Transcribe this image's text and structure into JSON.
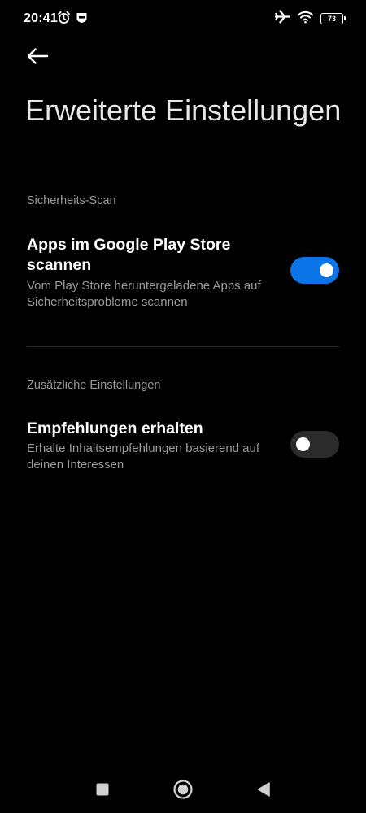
{
  "status_bar": {
    "time": "20:41",
    "battery_level": "73",
    "left_icons": [
      "alarm-icon",
      "notification-app-icon"
    ],
    "right_icons": [
      "airplane-mode-icon",
      "wifi-icon",
      "battery-icon"
    ]
  },
  "header": {
    "back_icon": "arrow-left-icon",
    "title": "Erweiterte Einstellungen"
  },
  "sections": [
    {
      "header": "Sicherheits-Scan",
      "items": [
        {
          "title": "Apps im Google Play Store scannen",
          "description": "Vom Play Store heruntergeladene Apps auf Sicherheitsprobleme scannen",
          "enabled": true
        }
      ]
    },
    {
      "header": "Zusätzliche Einstellungen",
      "items": [
        {
          "title": "Empfehlungen erhalten",
          "description": "Erhalte Inhaltsempfehlungen basierend auf deinen Interessen",
          "enabled": false
        }
      ]
    }
  ],
  "nav_bar": {
    "buttons": [
      "recents-square-icon",
      "home-circle-icon",
      "back-triangle-icon"
    ]
  },
  "colors": {
    "background": "#000000",
    "accent": "#0b74e6",
    "toggle_off": "#2b2b2b",
    "secondary_text": "#9a9a9a"
  }
}
